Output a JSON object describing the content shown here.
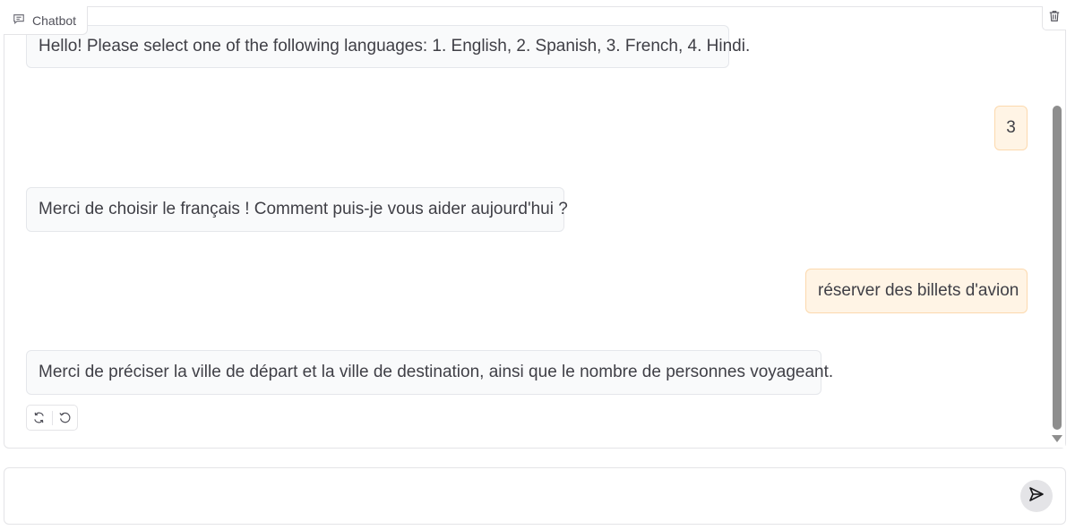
{
  "chatbot": {
    "label": "Chatbot",
    "messages": [
      {
        "role": "bot",
        "text": "Hello! Please select one of the following languages: 1. English, 2. Spanish, 3. French, 4. Hindi."
      },
      {
        "role": "user",
        "text": "3"
      },
      {
        "role": "bot",
        "text": "Merci de choisir le français ! Comment puis-je vous aider aujourd'hui ?"
      },
      {
        "role": "user",
        "text": "réserver des billets d'avion"
      },
      {
        "role": "bot",
        "text": "Merci de préciser la ville de départ et la ville de destination, ainsi que le nombre de personnes voyageant."
      }
    ]
  },
  "input": {
    "value": "",
    "placeholder": ""
  },
  "icons": {
    "label": "chat-icon",
    "clear": "trash-icon",
    "retry": "retry-icon",
    "undo": "undo-icon",
    "send": "send-icon"
  },
  "colors": {
    "bot_bubble": "#f9fafb",
    "user_bubble": "#fff4e5",
    "user_border": "#fcd9ae"
  }
}
